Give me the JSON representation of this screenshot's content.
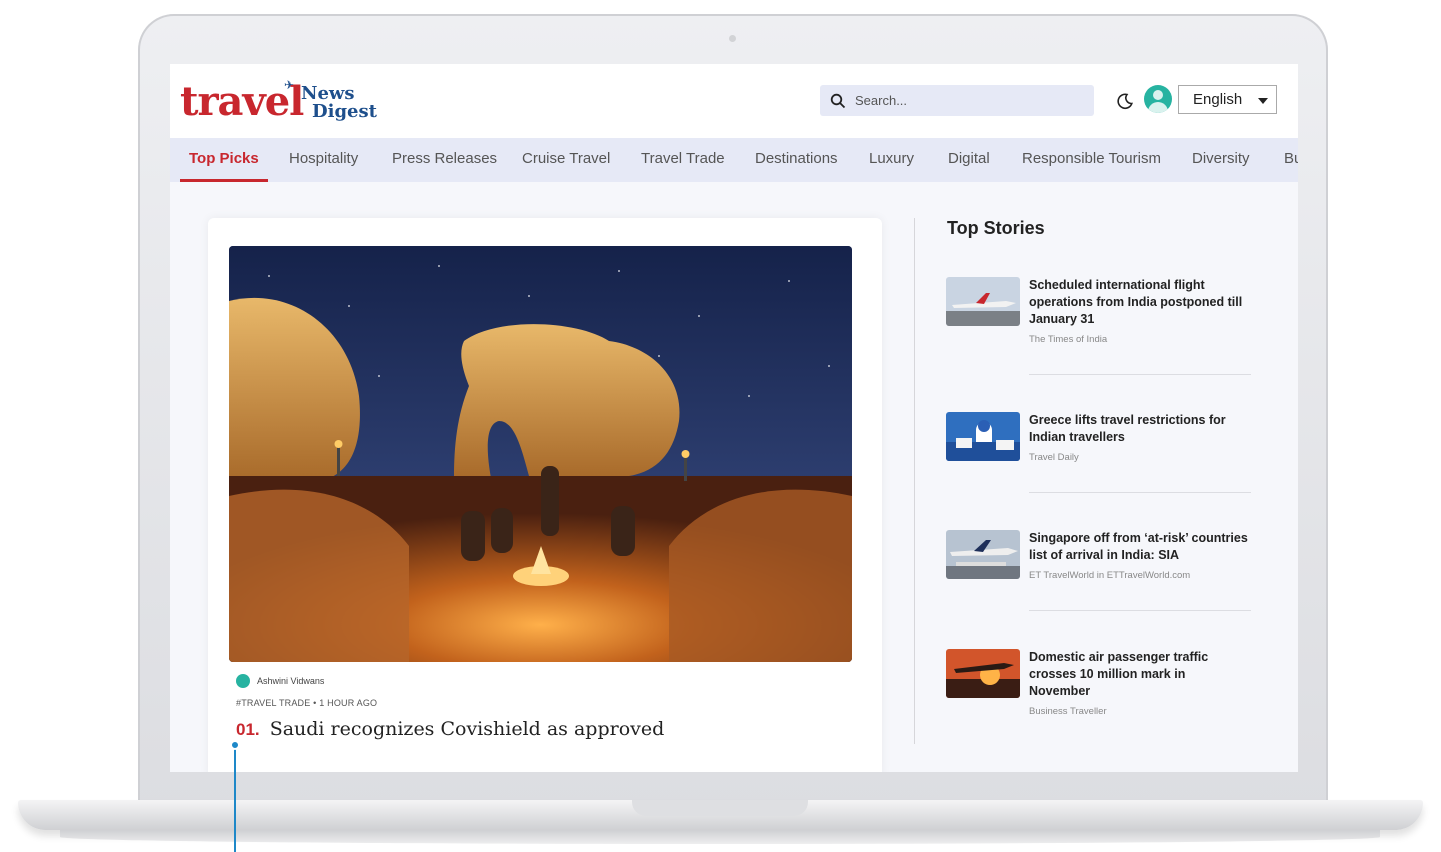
{
  "header": {
    "logo_travel": "travel",
    "logo_news": "News",
    "logo_digest": "Digest",
    "search_placeholder": "Search...",
    "language": "English"
  },
  "nav": {
    "items": [
      {
        "label": "Top Picks",
        "active": true
      },
      {
        "label": "Hospitality"
      },
      {
        "label": "Press Releases"
      },
      {
        "label": "Cruise Travel"
      },
      {
        "label": "Travel Trade"
      },
      {
        "label": "Destinations"
      },
      {
        "label": "Luxury"
      },
      {
        "label": "Digital"
      },
      {
        "label": "Responsible Tourism"
      },
      {
        "label": "Diversity"
      },
      {
        "label": "Bu"
      }
    ]
  },
  "feature": {
    "author": "Ashwini Vidwans",
    "tag": "#TRAVEL TRADE",
    "time": "1 HOUR AGO",
    "number": "01.",
    "headline": "Saudi recognizes Covishield as approved"
  },
  "top_stories": {
    "title": "Top Stories",
    "items": [
      {
        "title": "Scheduled international flight operations from India postponed till January 31",
        "source": "The Times of India"
      },
      {
        "title": "Greece lifts travel restrictions for Indian travellers",
        "source": "Travel Daily"
      },
      {
        "title": "Singapore off from ‘at-risk’ countries list of arrival in India: SIA",
        "source": "ET TravelWorld in ETTravelWorld.com"
      },
      {
        "title": "Domestic air passenger traffic crosses 10 million mark in November",
        "source": "Business Traveller"
      }
    ]
  },
  "colors": {
    "brand_red": "#c8272e",
    "brand_blue": "#1e4f8c",
    "nav_bg": "#e6e9f6",
    "accent_teal": "#27b3a1"
  }
}
